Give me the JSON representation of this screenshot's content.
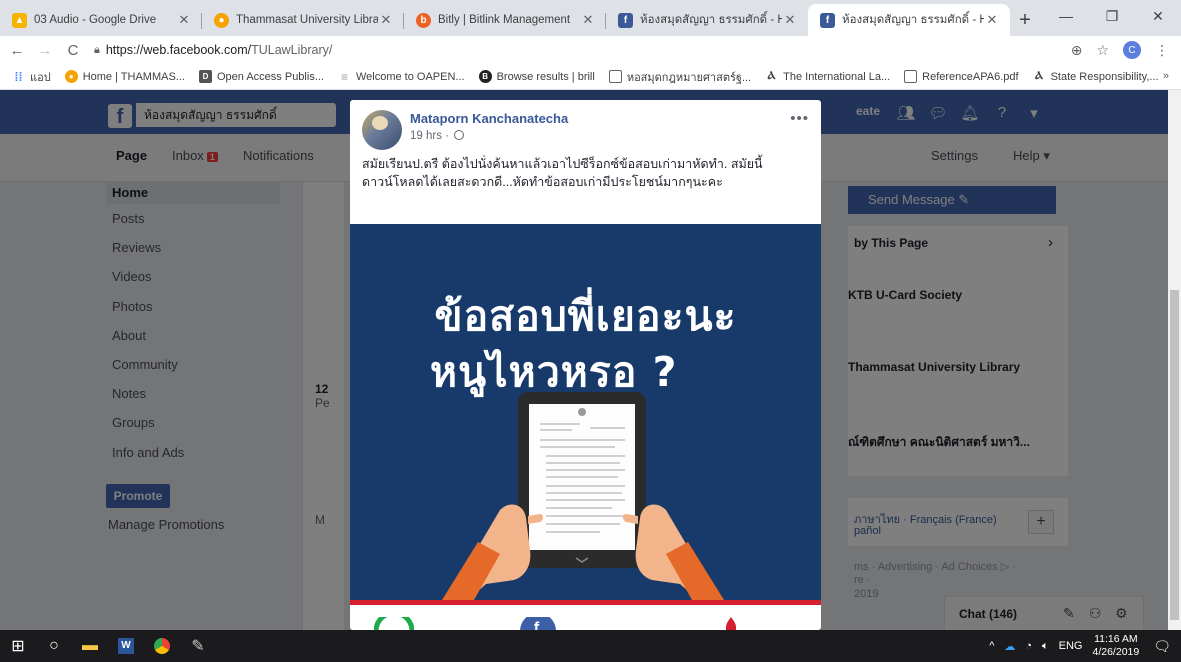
{
  "browser": {
    "tabs": [
      {
        "title": "03 Audio - Google Drive",
        "icon": "google-drive-icon",
        "color": "#f4b400"
      },
      {
        "title": "Thammasat University Library :",
        "icon": "library-icon",
        "color": "#f4a300"
      },
      {
        "title": "Bitly | Bitlink Management",
        "icon": "bitly-icon",
        "color": "#ee6123"
      },
      {
        "title": "ห้องสมุดสัญญา ธรรมศักดิ์ - Home",
        "icon": "facebook-icon",
        "color": "#3b5998"
      },
      {
        "title": "ห้องสมุดสัญญา ธรรมศักดิ์ - Home",
        "icon": "facebook-icon",
        "color": "#3b5998"
      }
    ],
    "url_host": "https://web.facebook.com/",
    "url_path": "TULawLibrary/",
    "profile_initial": "C",
    "bookmarks": [
      {
        "label": "แอป",
        "icon": "apps-grid-icon",
        "color": "#4285f4"
      },
      {
        "label": "Home | THAMMAS...",
        "icon": "library-icon",
        "color": "#f4a300"
      },
      {
        "label": "Open Access Publis...",
        "icon": "doaj-icon",
        "color": "#555555"
      },
      {
        "label": "Welcome to OAPEN...",
        "icon": "oapen-icon",
        "color": "#9e9e9e"
      },
      {
        "label": "Browse results | brill",
        "icon": "brill-icon",
        "color": "#222222"
      },
      {
        "label": "หอสมุดกฎหมายศาสตร์ฐ...",
        "icon": "page-icon",
        "color": "#ffffff"
      },
      {
        "label": "The International La...",
        "icon": "ilc-icon",
        "color": "#ffffff"
      },
      {
        "label": "ReferenceAPA6.pdf",
        "icon": "page-icon",
        "color": "#ffffff"
      },
      {
        "label": "State Responsibility,...",
        "icon": "ilc-icon",
        "color": "#ffffff"
      }
    ]
  },
  "facebook": {
    "page_search_value": "ห้องสมุดสัญญา ธรรมศักดิ์",
    "create_label": "eate",
    "subnav": {
      "page": "Page",
      "inbox": "Inbox",
      "inbox_badge": "1",
      "notifications": "Notifications",
      "settings": "Settings",
      "help": "Help ▾"
    },
    "left_nav": [
      "Home",
      "Posts",
      "Reviews",
      "Videos",
      "Photos",
      "About",
      "Community",
      "Notes",
      "Groups",
      "Info and Ads"
    ],
    "promote_label": "Promote",
    "manage_promotions": "Manage Promotions",
    "center_peek": {
      "num": "12",
      "p": "Pe",
      "m": "M"
    },
    "right": {
      "send_message": "Send Message ✎",
      "liked_by": "by This Page",
      "liked_pages": [
        "KTB U-Card Society",
        "Thammasat University Library",
        "ณ์ฑิตศึกษา คณะนิติศาสตร์ มหาวิ..."
      ],
      "languages": "ภาษาไทย · Français (France)",
      "languages2": "pañol",
      "footer1": "ms · Advertising · Ad Choices ▷ ·",
      "footer2": "re ·",
      "year": "2019"
    },
    "chat": {
      "label": "Chat (146)"
    }
  },
  "post": {
    "author": "Mataporn Kanchanatecha",
    "time": "19 hrs ·",
    "text": "สมัยเรียนป.ตรี ต้องไปนั่งค้นหาแล้วเอาไปซีร็อกซ์ข้อสอบเก่ามาหัดทำ. สมัยนี้ ดาวน์โหลดได้เลยสะดวกดี...หัดทำข้อสอบเก่ามีประโยชน์มากๆนะคะ",
    "image_headline_1": "ข้อสอบพี่เยอะนะ",
    "image_headline_2": "หนูไหวหรอ ?",
    "image_bg": "#173a6b",
    "accent_red": "#d41f2e"
  },
  "taskbar": {
    "time": "11:16 AM",
    "date": "4/26/2019",
    "lang": "ENG"
  }
}
